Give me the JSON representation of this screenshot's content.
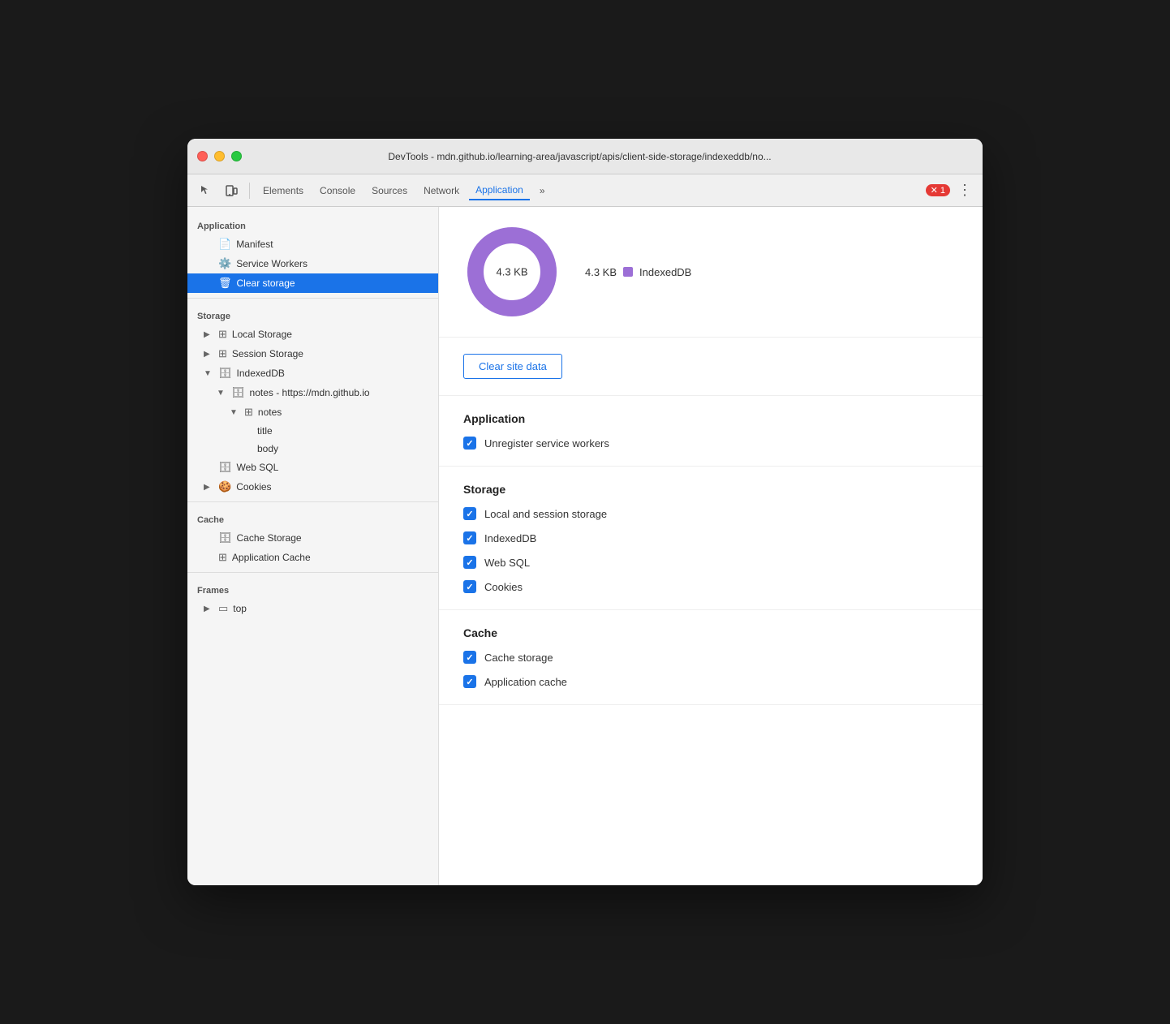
{
  "window": {
    "title": "DevTools - mdn.github.io/learning-area/javascript/apis/client-side-storage/indexeddb/no..."
  },
  "toolbar": {
    "inspect_label": "",
    "device_label": "",
    "elements_label": "Elements",
    "console_label": "Console",
    "sources_label": "Sources",
    "network_label": "Network",
    "application_label": "Application",
    "more_label": "»",
    "errors_count": "1",
    "more_options_label": "⋮"
  },
  "sidebar": {
    "application_section": "Application",
    "manifest_label": "Manifest",
    "service_workers_label": "Service Workers",
    "clear_storage_label": "Clear storage",
    "storage_section": "Storage",
    "local_storage_label": "Local Storage",
    "session_storage_label": "Session Storage",
    "indexeddb_label": "IndexedDB",
    "indexeddb_db_label": "notes - https://mdn.github.io",
    "indexeddb_store_label": "notes",
    "indexeddb_field1": "title",
    "indexeddb_field2": "body",
    "websql_label": "Web SQL",
    "cookies_label": "Cookies",
    "cache_section": "Cache",
    "cache_storage_label": "Cache Storage",
    "app_cache_label": "Application Cache",
    "frames_section": "Frames",
    "top_label": "top"
  },
  "content": {
    "donut_center_label": "4.3 KB",
    "legend_size": "4.3 KB",
    "legend_label": "IndexedDB",
    "legend_color": "#9c6fd6",
    "clear_btn_label": "Clear site data",
    "app_section_title": "Application",
    "unregister_sw_label": "Unregister service workers",
    "storage_section_title": "Storage",
    "local_session_label": "Local and session storage",
    "indexeddb_check_label": "IndexedDB",
    "websql_check_label": "Web SQL",
    "cookies_check_label": "Cookies",
    "cache_section_title": "Cache",
    "cache_storage_check_label": "Cache storage",
    "app_cache_check_label": "Application cache"
  }
}
